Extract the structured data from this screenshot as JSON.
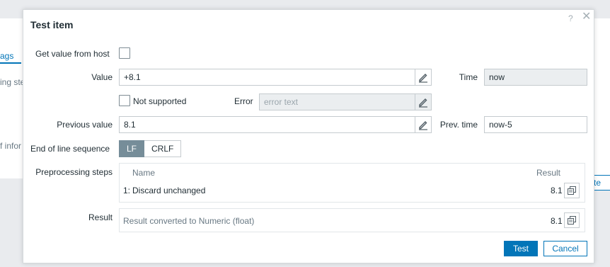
{
  "background": {
    "tab_fragment": "ags",
    "steps_fragment": "ing ste",
    "info_fragment": "f infor",
    "button_fragment": "te"
  },
  "dialog": {
    "title": "Test item",
    "help_icon": "?",
    "close_icon": "✕"
  },
  "form": {
    "get_value_from_host_label": "Get value from host",
    "get_value_from_host_checked": false,
    "value_label": "Value",
    "value": "+8.1",
    "time_label": "Time",
    "time_value": "now",
    "not_supported_label": "Not supported",
    "not_supported_checked": false,
    "error_label": "Error",
    "error_placeholder": "error text",
    "previous_value_label": "Previous value",
    "previous_value": "8.1",
    "prev_time_label": "Prev. time",
    "prev_time_value": "now-5",
    "eol_label": "End of line sequence",
    "eol_options": [
      "LF",
      "CRLF"
    ],
    "eol_selected": "LF"
  },
  "preprocessing": {
    "label": "Preprocessing steps",
    "col_name": "Name",
    "col_result": "Result",
    "steps": [
      {
        "index": "1:",
        "name": "Discard unchanged",
        "result": "8.1"
      }
    ]
  },
  "result": {
    "label": "Result",
    "text": "Result converted to Numeric (float)",
    "value": "8.1"
  },
  "buttons": {
    "test": "Test",
    "cancel": "Cancel"
  },
  "colors": {
    "accent": "#0275b8",
    "segment_active": "#768d99"
  },
  "icons": {
    "edit": "pencil-icon",
    "copy": "copy-icon"
  }
}
